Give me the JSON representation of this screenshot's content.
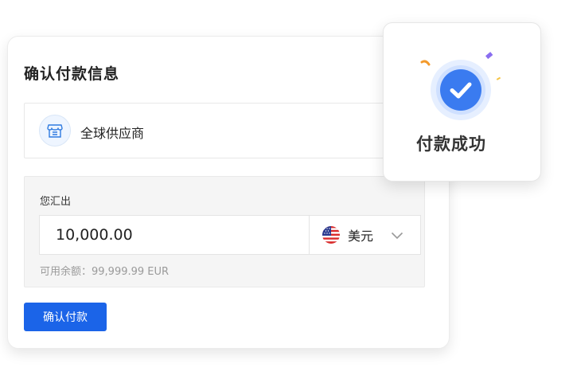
{
  "confirm_card": {
    "title": "确认付款信息",
    "supplier": {
      "icon": "store-icon",
      "name": "全球供应商"
    },
    "amount_section": {
      "label": "您汇出",
      "amount_value": "10,000.00",
      "currency": {
        "flag_icon": "us-flag-icon",
        "label": "美元"
      },
      "balance_text": "可用余额：99,999.99 EUR"
    },
    "confirm_button_label": "确认付款"
  },
  "success_popup": {
    "icon": "check-circle-icon",
    "text": "付款成功"
  },
  "colors": {
    "primary": "#1b64e8",
    "success_icon": "#3a7bf0",
    "panel_bg": "#f5f5f5",
    "muted_text": "#9a9a9a"
  }
}
